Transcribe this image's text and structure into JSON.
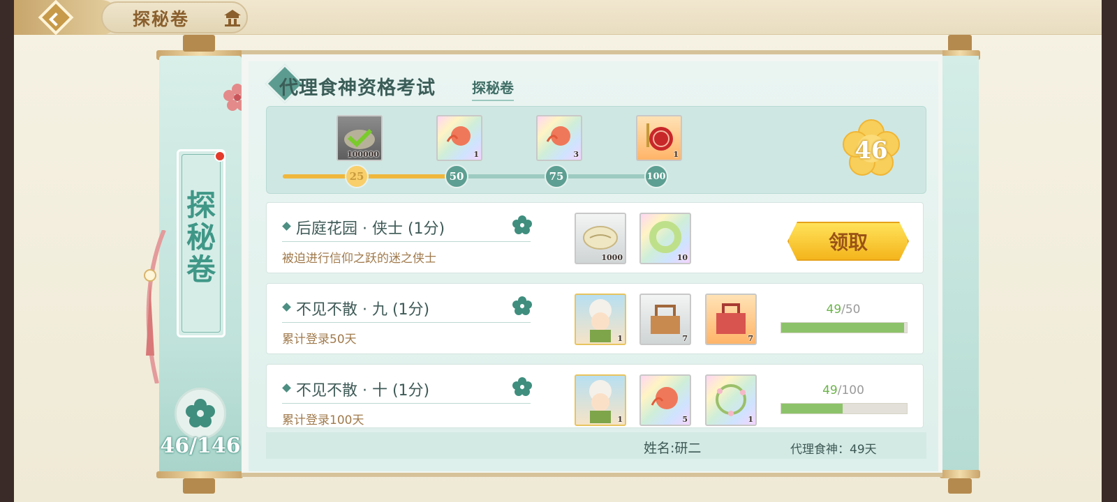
{
  "header": {
    "title": "探秘卷",
    "back_icon": "back-arrow-icon",
    "home_icon": "pagoda-home-icon"
  },
  "side": {
    "label": "探秘卷",
    "count": "46/146",
    "icon": "flower-icon"
  },
  "panel": {
    "title": "代理食神资格考试",
    "subtitle": "探秘卷"
  },
  "track": {
    "score": "46",
    "progress_fraction": 0.46,
    "milestones": [
      "25",
      "50",
      "75",
      "100"
    ],
    "rewards": [
      {
        "qty": "100000",
        "icon": "checked-shell-icon",
        "style": "grey"
      },
      {
        "qty": "1",
        "icon": "peach-token-icon",
        "style": "rainbow"
      },
      {
        "qty": "3",
        "icon": "peach-token-icon",
        "style": "rainbow"
      },
      {
        "qty": "1",
        "icon": "red-seal-icon",
        "style": "orange"
      }
    ]
  },
  "tasks": [
    {
      "title": "后庭花园 · 侠士 (1分)",
      "desc": "被迫进行信仰之跃的迷之侠士",
      "claim_label": "领取",
      "rewards": [
        {
          "qty": "1000",
          "icon": "shell-coin-icon",
          "style": "silver"
        },
        {
          "qty": "10",
          "icon": "jade-ring-icon",
          "style": "rainbow"
        }
      ]
    },
    {
      "title": "不见不散 · 九 (1分)",
      "desc": "累计登录50天",
      "progress_current": "49",
      "progress_total": "/50",
      "progress_fraction": 0.98,
      "rewards": [
        {
          "qty": "1",
          "icon": "chef-portrait-icon",
          "style": "portrait"
        },
        {
          "qty": "7",
          "icon": "wooden-basket-icon",
          "style": "silver"
        },
        {
          "qty": "7",
          "icon": "red-gift-box-icon",
          "style": "orange"
        }
      ]
    },
    {
      "title": "不见不散 · 十 (1分)",
      "desc": "累计登录100天",
      "progress_current": "49",
      "progress_total": "/100",
      "progress_fraction": 0.49,
      "rewards": [
        {
          "qty": "1",
          "icon": "chef-portrait-icon",
          "style": "portrait"
        },
        {
          "qty": "5",
          "icon": "peach-token-icon",
          "style": "rainbow"
        },
        {
          "qty": "1",
          "icon": "flower-wreath-icon",
          "style": "rainbow"
        }
      ]
    }
  ],
  "footer": {
    "name": "姓名:研二",
    "days": "代理食神：49天"
  },
  "colors": {
    "accent_teal": "#5d9f92",
    "gold": "#f0b73d",
    "progress_green": "#8cc36a"
  }
}
